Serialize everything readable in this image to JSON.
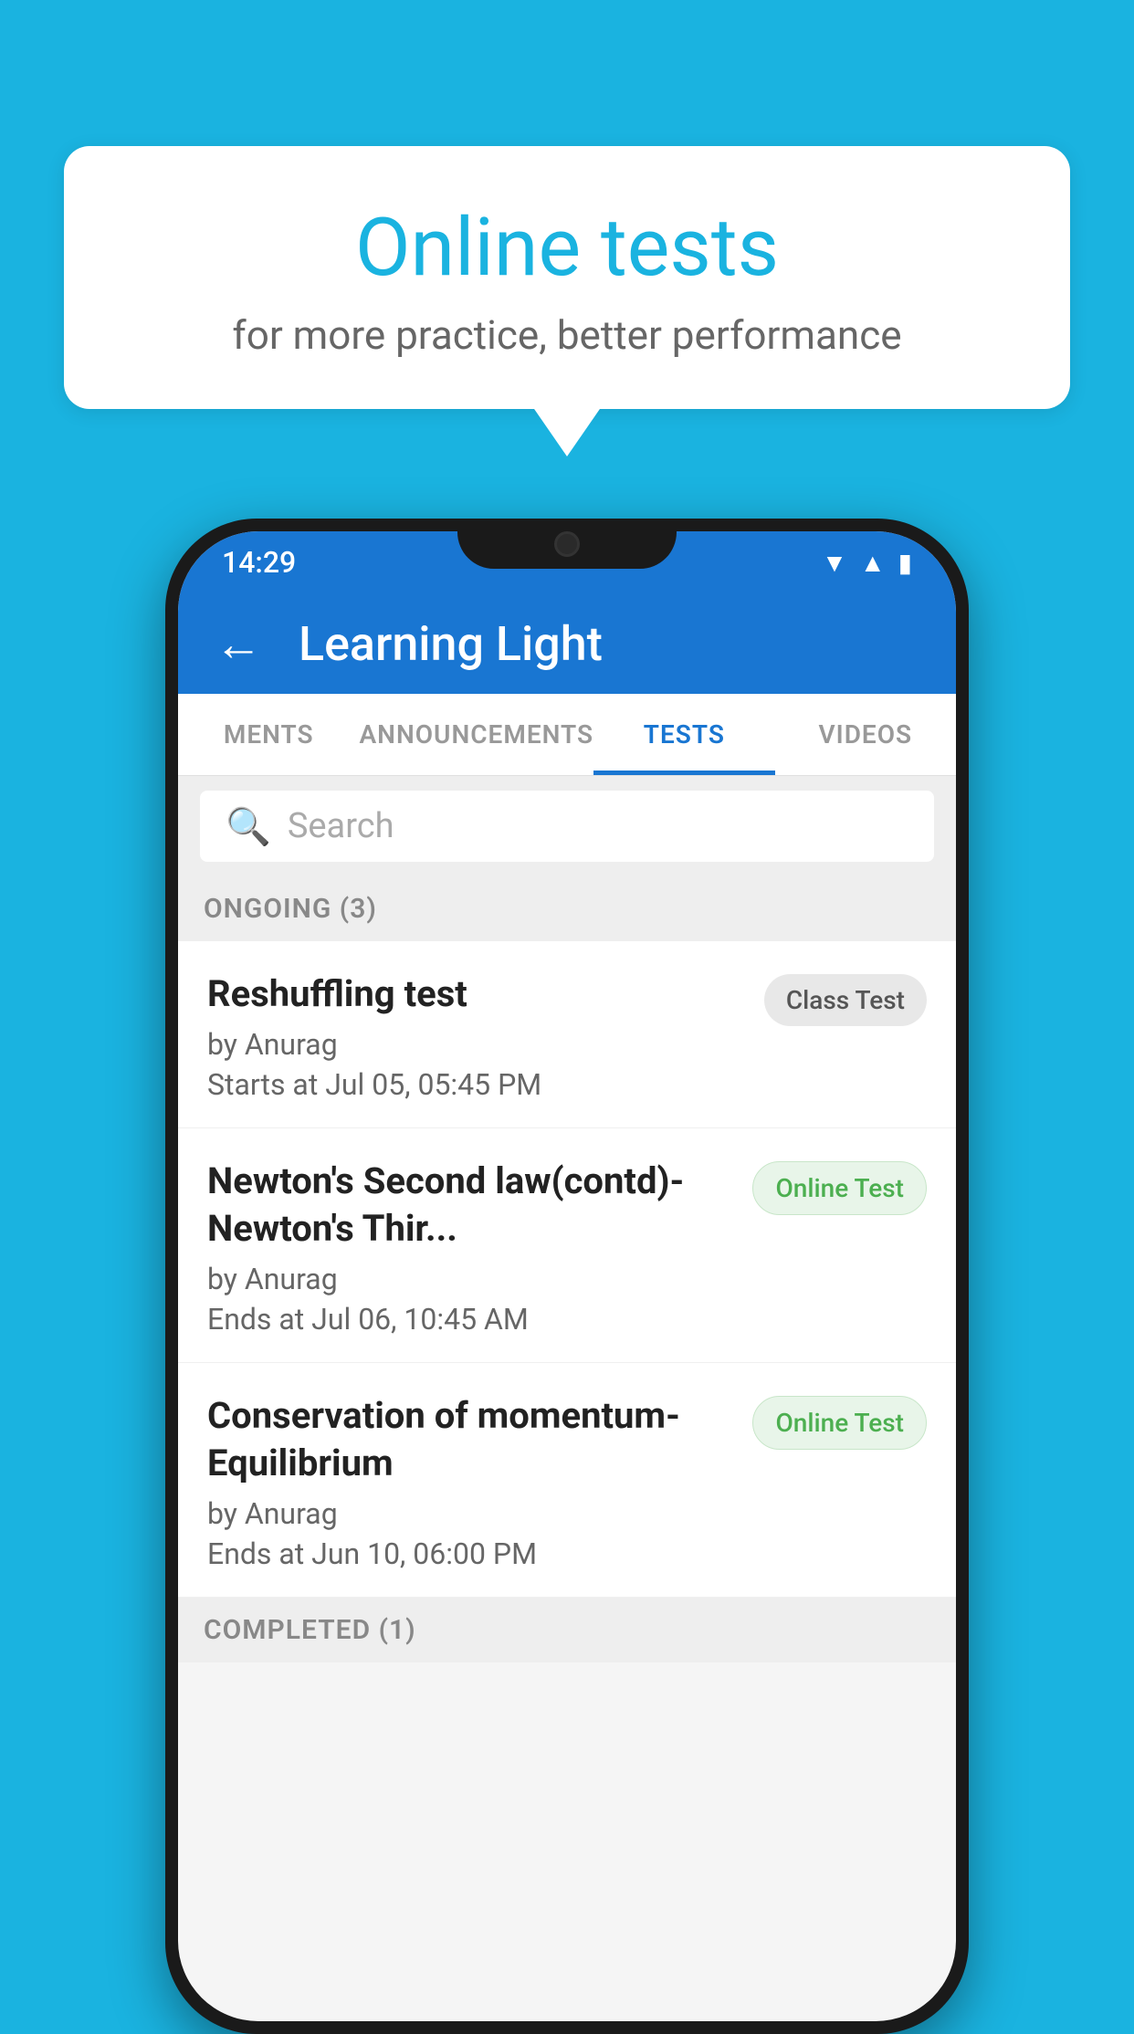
{
  "background": {
    "color": "#1ab3e0"
  },
  "speech_bubble": {
    "title": "Online tests",
    "subtitle": "for more practice, better performance"
  },
  "phone": {
    "status_bar": {
      "time": "14:29",
      "icons": [
        "wifi",
        "signal",
        "battery"
      ]
    },
    "top_bar": {
      "title": "Learning Light",
      "back_label": "←"
    },
    "tabs": [
      {
        "label": "MENTS",
        "active": false
      },
      {
        "label": "ANNOUNCEMENTS",
        "active": false
      },
      {
        "label": "TESTS",
        "active": true
      },
      {
        "label": "VIDEOS",
        "active": false
      }
    ],
    "search": {
      "placeholder": "Search"
    },
    "ongoing_section": {
      "label": "ONGOING (3)"
    },
    "tests": [
      {
        "title": "Reshuffling test",
        "author": "by Anurag",
        "date": "Starts at  Jul 05, 05:45 PM",
        "badge": "Class Test",
        "badge_type": "class"
      },
      {
        "title": "Newton's Second law(contd)-Newton's Thir...",
        "author": "by Anurag",
        "date": "Ends at  Jul 06, 10:45 AM",
        "badge": "Online Test",
        "badge_type": "online"
      },
      {
        "title": "Conservation of momentum-Equilibrium",
        "author": "by Anurag",
        "date": "Ends at  Jun 10, 06:00 PM",
        "badge": "Online Test",
        "badge_type": "online"
      }
    ],
    "completed_section": {
      "label": "COMPLETED (1)"
    }
  }
}
